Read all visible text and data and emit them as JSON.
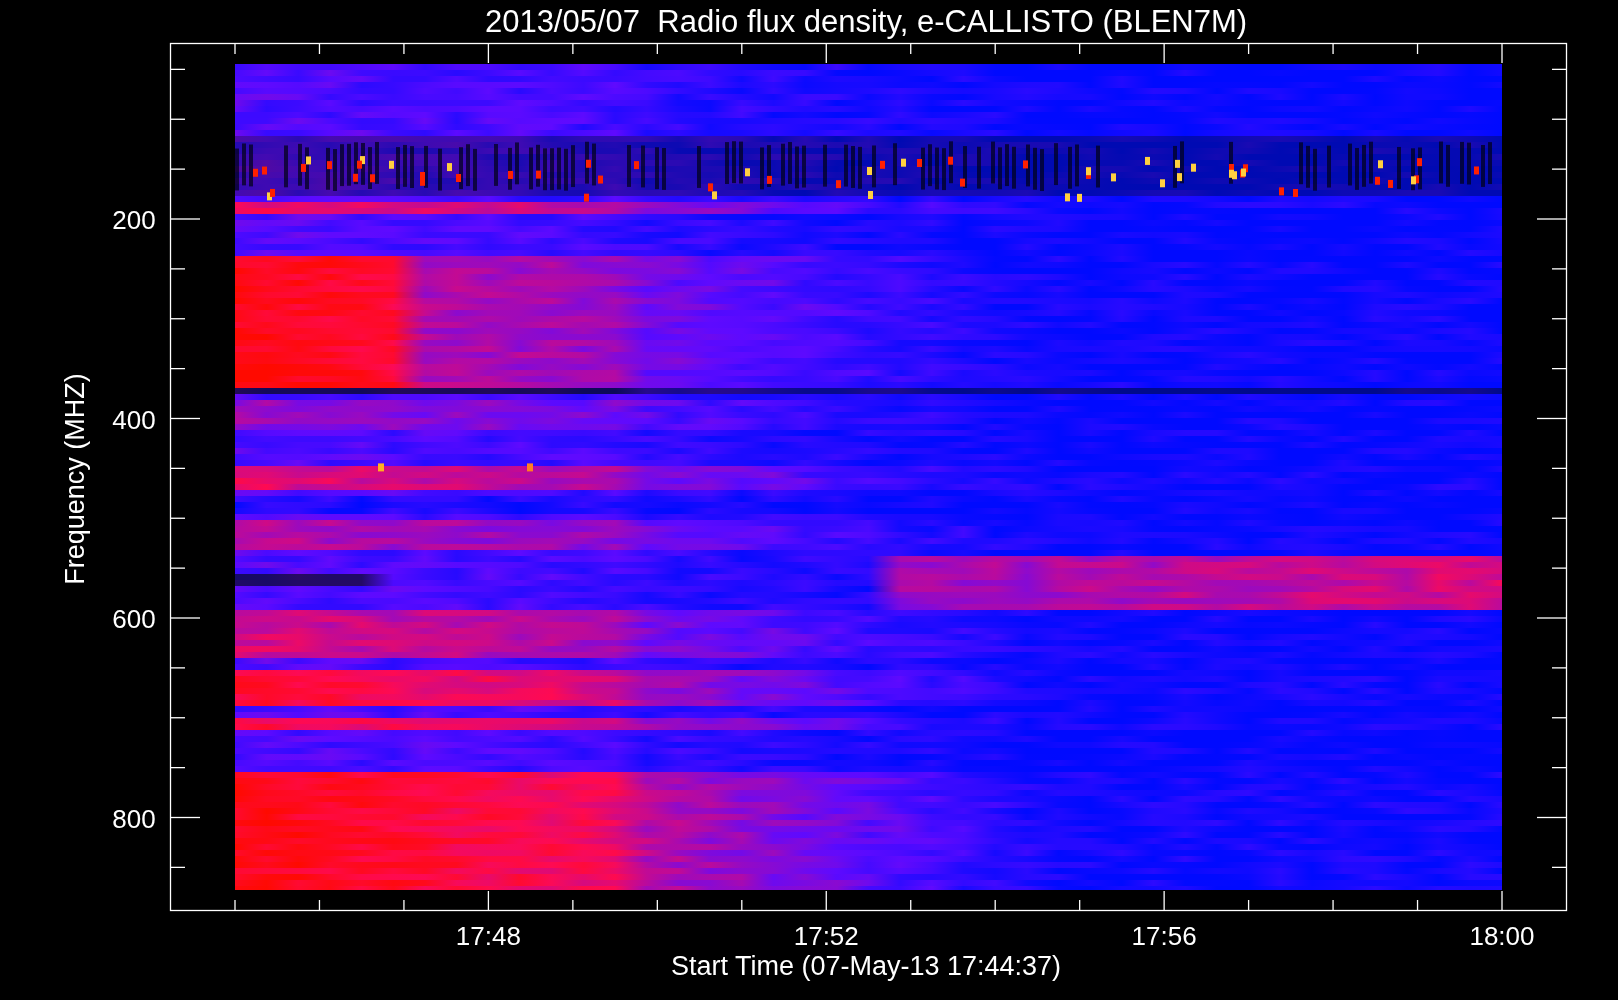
{
  "plot": {
    "title": "2013/05/07  Radio flux density, e-CALLISTO (BLEN7M)",
    "ylabel": "Frequency (MHZ)",
    "xlabel": "Start Time (07-May-13 17:44:37)",
    "yticks": [
      "200",
      "400",
      "600",
      "800"
    ],
    "xticks": [
      "17:48",
      "17:52",
      "17:56",
      "18:00"
    ]
  }
}
